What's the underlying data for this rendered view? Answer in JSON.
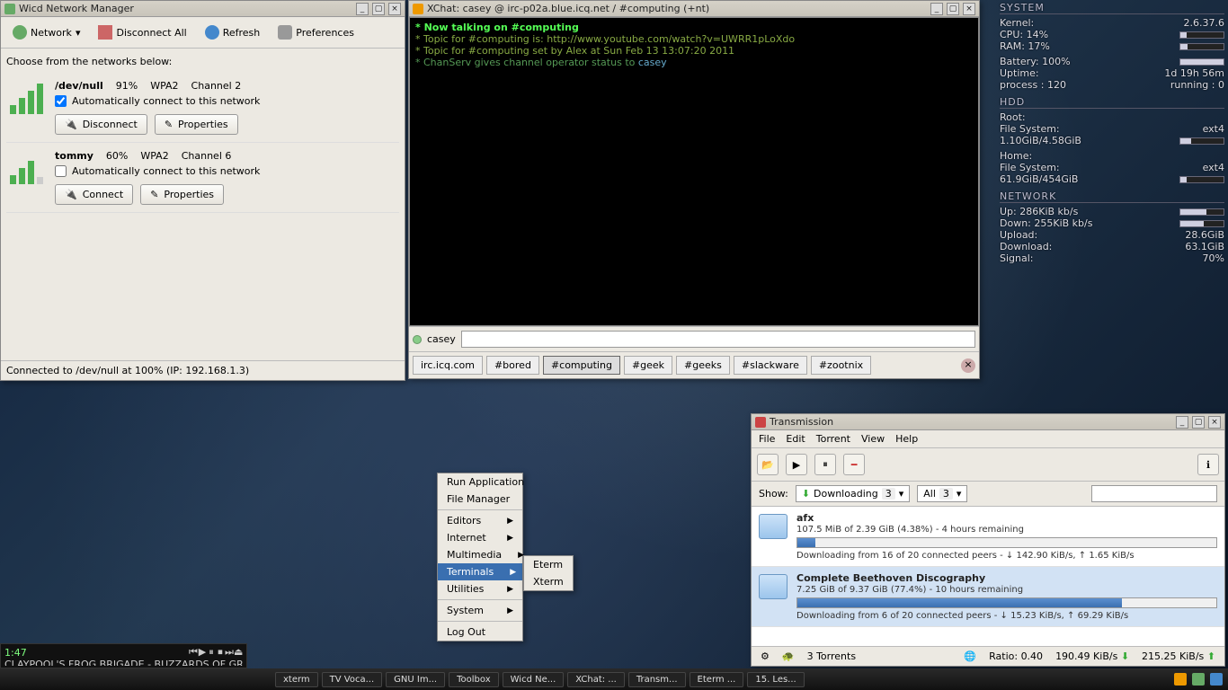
{
  "wicd": {
    "title": "Wicd Network Manager",
    "toolbar": {
      "network": "Network",
      "disconnect_all": "Disconnect All",
      "refresh": "Refresh",
      "preferences": "Preferences"
    },
    "prompt": "Choose from the networks below:",
    "auto_label": "Automatically connect to this network",
    "btn_disconnect": "Disconnect",
    "btn_connect": "Connect",
    "btn_properties": "Properties",
    "networks": [
      {
        "ssid": "/dev/null",
        "signal": "91%",
        "security": "WPA2",
        "channel": "Channel 2",
        "auto": true,
        "connected": true,
        "bars": [
          10,
          18,
          26,
          34
        ]
      },
      {
        "ssid": "tommy",
        "signal": "60%",
        "security": "WPA2",
        "channel": "Channel 6",
        "auto": false,
        "connected": false,
        "bars": [
          10,
          18,
          26,
          8
        ]
      }
    ],
    "status": "Connected to /dev/null at 100% (IP: 192.168.1.3)"
  },
  "xchat": {
    "title": "XChat: casey @ irc-p02a.blue.icq.net / #computing (+nt)",
    "lines": [
      {
        "prefix": "* ",
        "cls": "green",
        "text": "Now talking on #computing"
      },
      {
        "prefix": "* ",
        "cls": "olive",
        "text": "Topic for #computing is: http://www.youtube.com/watch?v=UWRR1pLoXdo"
      },
      {
        "prefix": "* ",
        "cls": "olive",
        "text": "Topic for #computing set by Alex at Sun Feb 13 13:07:20 2011"
      },
      {
        "prefix": "* ",
        "cls": "dkgreen",
        "text": "ChanServ gives channel operator status to ",
        "tail": "casey",
        "tailcls": "cyan"
      }
    ],
    "nick": "casey",
    "input": "",
    "server_tab": "irc.icq.com",
    "channels": [
      "#bored",
      "#computing",
      "#geek",
      "#geeks",
      "#slackware",
      "#zootnix"
    ],
    "active_channel": "#computing"
  },
  "conky": {
    "system_hd": "SYSTEM",
    "kernel_l": "Kernel:",
    "kernel_v": "2.6.37.6",
    "cpu_l": "CPU:",
    "cpu_v": "14%",
    "cpu_pct": 14,
    "ram_l": "RAM:",
    "ram_v": "17%",
    "ram_pct": 17,
    "bat_l": "Battery:",
    "bat_v": "100%",
    "bat_pct": 100,
    "up_l": "Uptime:",
    "up_v": "1d 19h 56m",
    "proc_l": "process :",
    "proc_v": "120",
    "run_l": "running :",
    "run_v": "0",
    "hdd_hd": "HDD",
    "root_l": "Root:",
    "root_fs": "File System:",
    "root_fs_v": "ext4",
    "root_use": "1.10GiB/4.58GiB",
    "root_pct": 24,
    "home_l": "Home:",
    "home_fs": "File System:",
    "home_fs_v": "ext4",
    "home_use": "61.9GiB/454GiB",
    "home_pct": 14,
    "net_hd": "NETWORK",
    "upspd_l": "Up:",
    "upspd_v": "286KiB kb/s",
    "dnspd_l": "Down:",
    "dnspd_v": "255KiB kb/s",
    "upload_l": "Upload:",
    "upload_v": "28.6GiB",
    "download_l": "Download:",
    "download_v": "63.1GiB",
    "signal_l": "Signal:",
    "signal_v": "70%"
  },
  "trans": {
    "title": "Transmission",
    "menu": {
      "file": "File",
      "edit": "Edit",
      "torrent": "Torrent",
      "view": "View",
      "help": "Help"
    },
    "show_l": "Show:",
    "filter1": "Downloading",
    "filter1_n": "3",
    "filter2": "All",
    "filter2_n": "3",
    "search": "",
    "torrents": [
      {
        "name": "afx",
        "sub": "107.5 MiB of 2.39 GiB (4.38%) - 4 hours remaining",
        "pct": 4.38,
        "stat": "Downloading from 16 of 20 connected peers - ↓ 142.90 KiB/s, ↑ 1.65 KiB/s",
        "sel": false
      },
      {
        "name": "Complete Beethoven Discography",
        "sub": "7.25 GiB of 9.37 GiB (77.4%) - 10 hours remaining",
        "pct": 77.4,
        "stat": "Downloading from 6 of 20 connected peers - ↓ 15.23 KiB/s, ↑ 69.29 KiB/s",
        "sel": true
      }
    ],
    "status": {
      "count": "3 Torrents",
      "ratio_l": "Ratio:",
      "ratio_v": "0.40",
      "dn": "190.49 KiB/s",
      "up": "215.25 KiB/s"
    }
  },
  "ctx": {
    "items": [
      {
        "label": "Run Application",
        "sub": false
      },
      {
        "label": "File Manager",
        "sub": false
      },
      {
        "sep": true
      },
      {
        "label": "Editors",
        "sub": true
      },
      {
        "label": "Internet",
        "sub": true
      },
      {
        "label": "Multimedia",
        "sub": true
      },
      {
        "label": "Terminals",
        "sub": true,
        "sel": true
      },
      {
        "label": "Utilities",
        "sub": true
      },
      {
        "sep": true
      },
      {
        "label": "System",
        "sub": true
      },
      {
        "sep": true
      },
      {
        "label": "Log Out",
        "sub": false
      }
    ],
    "sub": [
      "Eterm",
      "Xterm"
    ]
  },
  "aud": {
    "time": "1:47",
    "track": "CLAYPOOL'S FROG BRIGADE - BUZZARDS OF GREEN HIL"
  },
  "taskbar": {
    "tasks": [
      "xterm",
      "TV Voca...",
      "GNU Im...",
      "Toolbox",
      "Wicd Ne...",
      "XChat: ...",
      "Transm...",
      "Eterm ...",
      "15. Les..."
    ]
  }
}
